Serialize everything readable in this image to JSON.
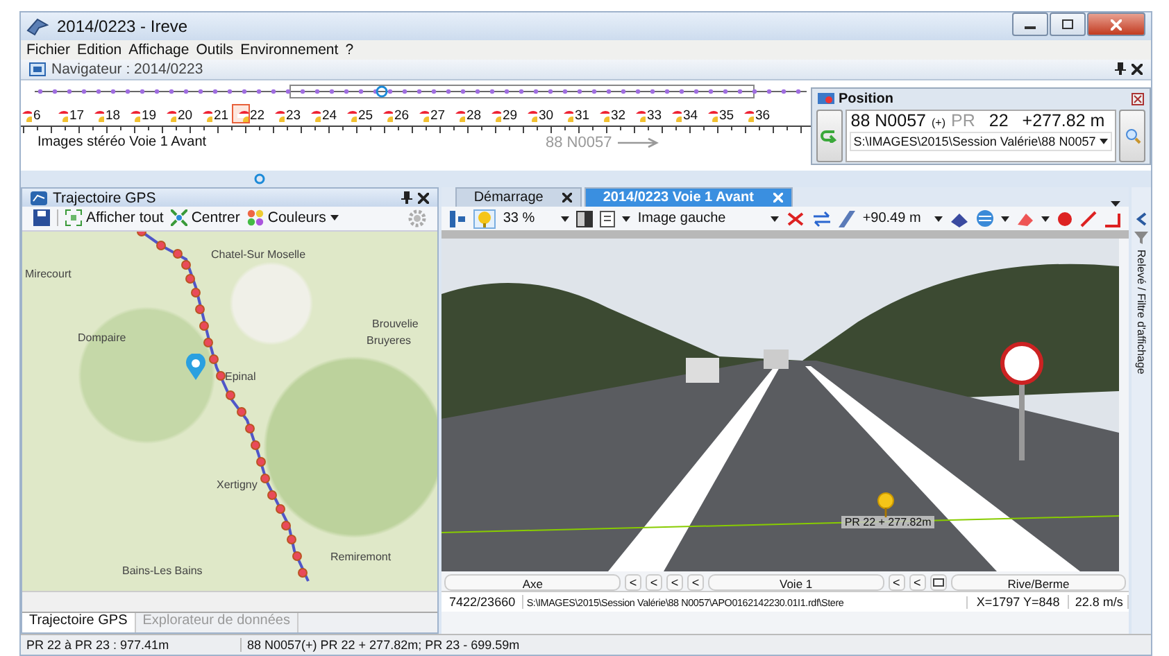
{
  "window": {
    "title": "2014/0223 - Ireve"
  },
  "menu": [
    "Fichier",
    "Edition",
    "Affichage",
    "Outils",
    "Environnement",
    "?"
  ],
  "navigator": {
    "title": "Navigateur : 2014/0223",
    "track_label": "Images stéréo Voie 1 Avant",
    "road_label": "88 N0057",
    "markers": [
      {
        "label": "6",
        "selected": false
      },
      {
        "label": "17",
        "selected": false
      },
      {
        "label": "18",
        "selected": false
      },
      {
        "label": "19",
        "selected": false
      },
      {
        "label": "20",
        "selected": false
      },
      {
        "label": "21",
        "selected": false
      },
      {
        "label": "22",
        "selected": true
      },
      {
        "label": "23",
        "selected": false
      },
      {
        "label": "24",
        "selected": false
      },
      {
        "label": "25",
        "selected": false
      },
      {
        "label": "26",
        "selected": false
      },
      {
        "label": "27",
        "selected": false
      },
      {
        "label": "28",
        "selected": false
      },
      {
        "label": "29",
        "selected": false
      },
      {
        "label": "30",
        "selected": false
      },
      {
        "label": "31",
        "selected": false
      },
      {
        "label": "32",
        "selected": false
      },
      {
        "label": "33",
        "selected": false
      },
      {
        "label": "34",
        "selected": false
      },
      {
        "label": "35",
        "selected": false
      },
      {
        "label": "36",
        "selected": false
      }
    ]
  },
  "position": {
    "title": "Position",
    "road": "88 N0057",
    "side": "(+)",
    "pr_label": "PR",
    "pr": "22",
    "offset": "+277.82 m",
    "path": "S:\\IMAGES\\2015\\Session Valérie\\88 N0057"
  },
  "gps_panel": {
    "title": "Trajectoire GPS",
    "buttons": [
      {
        "kind": "fit",
        "label": "Afficher tout"
      },
      {
        "kind": "center",
        "label": "Centrer"
      },
      {
        "kind": "colors",
        "label": "Couleurs"
      }
    ],
    "places": [
      "Chatel-Sur Moselle",
      "Mirecourt",
      "Dompaire",
      "Epinal",
      "Brouvelie",
      "Bruyeres",
      "Xertigny",
      "Bains-Les Bains",
      "Remiremont"
    ],
    "tabs": [
      {
        "label": "Trajectoire GPS",
        "selected": true
      },
      {
        "label": "Explorateur de données",
        "selected": false
      }
    ]
  },
  "viewer": {
    "tabs": [
      {
        "label": "Démarrage",
        "selected": false
      },
      {
        "label": "2014/0223 Voie 1 Avant",
        "selected": true
      }
    ],
    "marker_on": true,
    "zoom": "33 %",
    "image": "Image gauche",
    "distance": "+90.49 m",
    "photo_label": "PR 22 + 277.82m",
    "lanes": [
      {
        "kind": "lane",
        "label": "Axe"
      },
      {
        "kind": "arrow",
        "label": "<"
      },
      {
        "kind": "arrow",
        "label": "<"
      },
      {
        "kind": "arrow",
        "label": "<"
      },
      {
        "kind": "arrow",
        "label": "<"
      },
      {
        "kind": "lane",
        "label": "Voie 1"
      },
      {
        "kind": "arrow",
        "label": "<"
      },
      {
        "kind": "arrow",
        "label": "<"
      },
      {
        "kind": "icon"
      },
      {
        "kind": "lane",
        "label": "Rive/Berme"
      }
    ],
    "info": [
      "7422/23660",
      "S:\\IMAGES\\2015\\Session Valérie\\88 N0057\\APO0162142230.01I1.rdf\\Stere",
      "X=1797 Y=848",
      "22.8 m/s"
    ]
  },
  "side_panel": {
    "label": "Relevé / Filtre d'affichage"
  },
  "status_bar": [
    "PR 22 à PR 23 : 977.41m",
    "88 N0057(+) PR 22 + 277.82m; PR 23 - 699.59m"
  ]
}
